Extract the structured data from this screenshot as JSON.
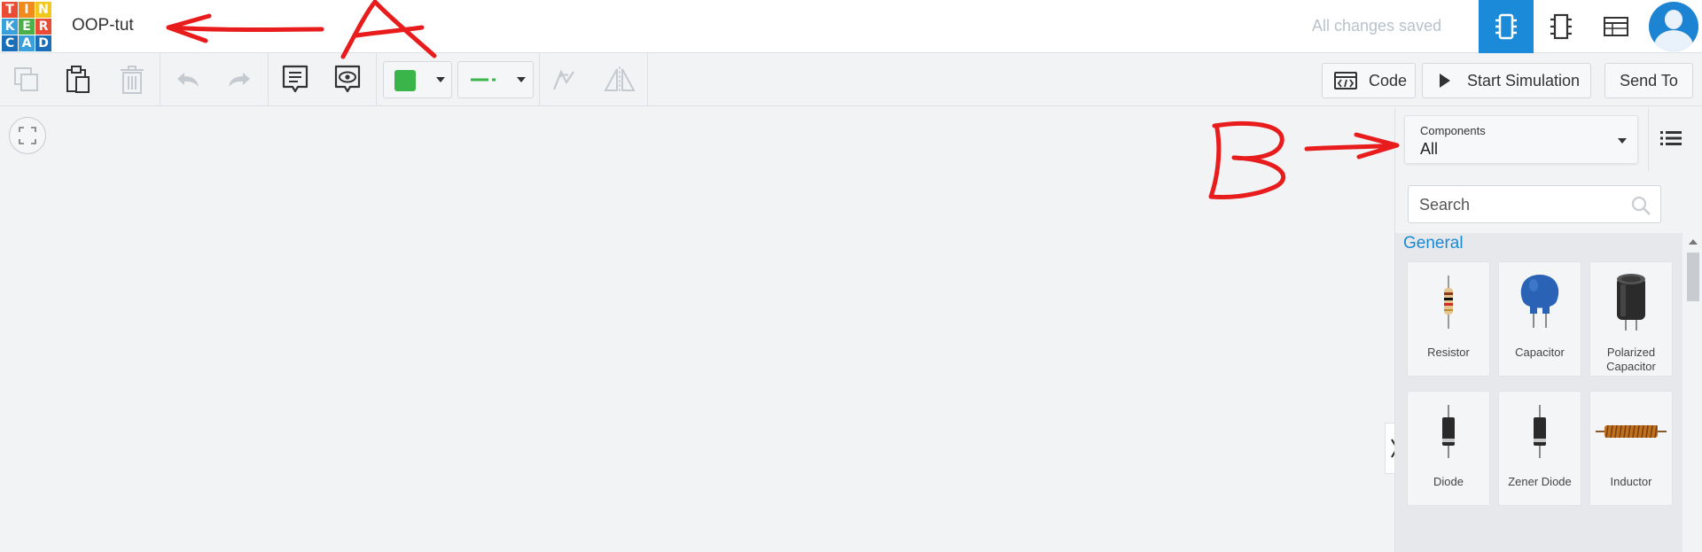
{
  "app": {
    "name": "Tinkercad",
    "logo_letters": [
      "T",
      "I",
      "N",
      "K",
      "E",
      "R",
      "C",
      "A",
      "D"
    ]
  },
  "header": {
    "project_title": "OOP-tut",
    "save_status": "All changes saved",
    "views": [
      "circuit-view-icon",
      "schematic-view-icon",
      "component-list-icon"
    ],
    "active_view": "circuit-view-icon"
  },
  "toolbar": {
    "code_label": "Code",
    "start_sim_label": "Start Simulation",
    "send_to_label": "Send To",
    "wire_color": "#3ab54a"
  },
  "panel": {
    "components_label": "Components",
    "components_value": "All",
    "search_placeholder": "Search",
    "category": "General",
    "parts": [
      {
        "name": "Resistor",
        "icon": "resistor-icon"
      },
      {
        "name": "Capacitor",
        "icon": "capacitor-icon"
      },
      {
        "name": "Polarized Capacitor",
        "icon": "polarized-capacitor-icon"
      },
      {
        "name": "Diode",
        "icon": "diode-icon"
      },
      {
        "name": "Zener Diode",
        "icon": "zener-diode-icon"
      },
      {
        "name": "Inductor",
        "icon": "inductor-icon"
      }
    ]
  },
  "annotations": {
    "label_a": "A",
    "label_b": "B",
    "color": "#e81c1c"
  }
}
